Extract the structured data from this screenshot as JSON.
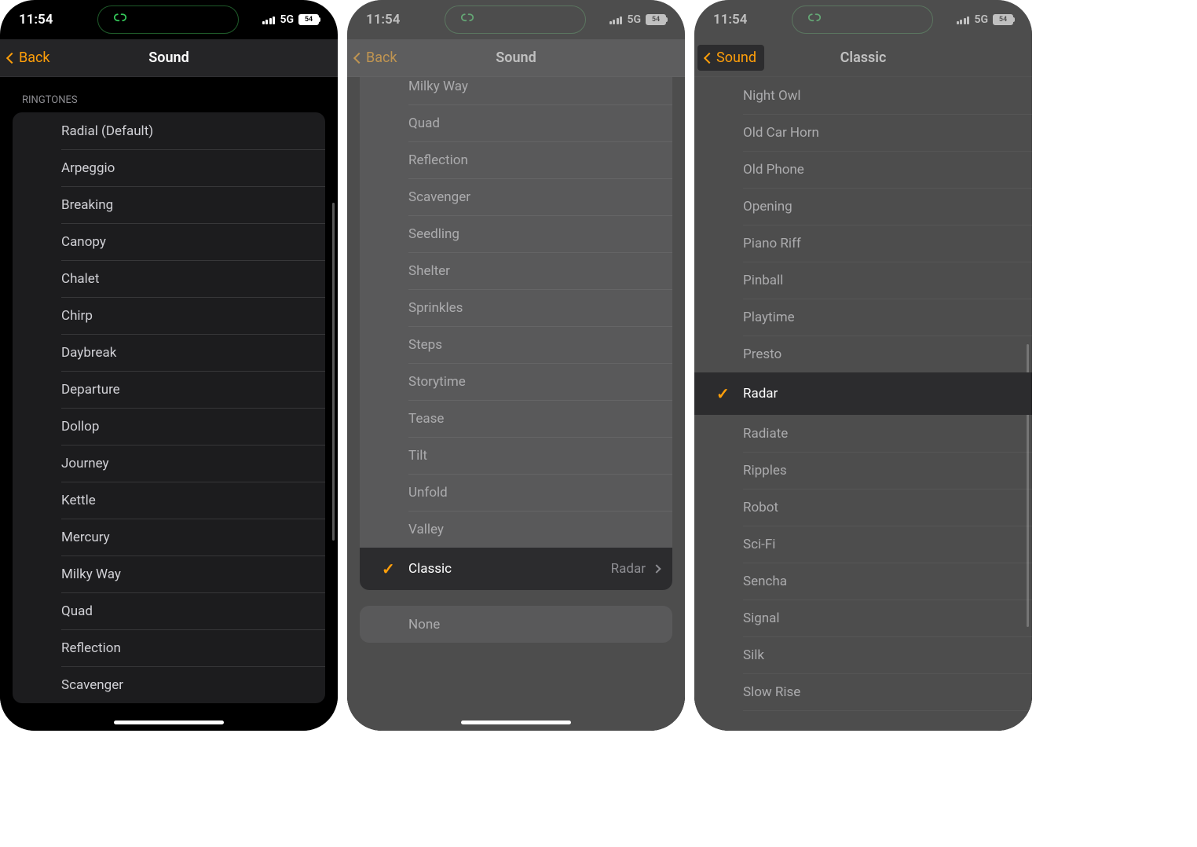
{
  "status": {
    "time": "11:54",
    "network": "5G",
    "battery": "54"
  },
  "panel1": {
    "back_label": "Back",
    "title": "Sound",
    "section": "RINGTONES",
    "items": [
      "Radial (Default)",
      "Arpeggio",
      "Breaking",
      "Canopy",
      "Chalet",
      "Chirp",
      "Daybreak",
      "Departure",
      "Dollop",
      "Journey",
      "Kettle",
      "Mercury",
      "Milky Way",
      "Quad",
      "Reflection",
      "Scavenger"
    ]
  },
  "panel2": {
    "back_label": "Back",
    "title": "Sound",
    "items": [
      "Milky Way",
      "Quad",
      "Reflection",
      "Scavenger",
      "Seedling",
      "Shelter",
      "Sprinkles",
      "Steps",
      "Storytime",
      "Tease",
      "Tilt",
      "Unfold",
      "Valley"
    ],
    "classic_label": "Classic",
    "classic_detail": "Radar",
    "none_label": "None"
  },
  "panel3": {
    "back_label": "Sound",
    "title": "Classic",
    "items_before": [
      "Night Owl",
      "Old Car Horn",
      "Old Phone",
      "Opening",
      "Piano Riff",
      "Pinball",
      "Playtime",
      "Presto"
    ],
    "selected": "Radar",
    "items_after": [
      "Radiate",
      "Ripples",
      "Robot",
      "Sci-Fi",
      "Sencha",
      "Signal",
      "Silk",
      "Slow Rise"
    ]
  }
}
